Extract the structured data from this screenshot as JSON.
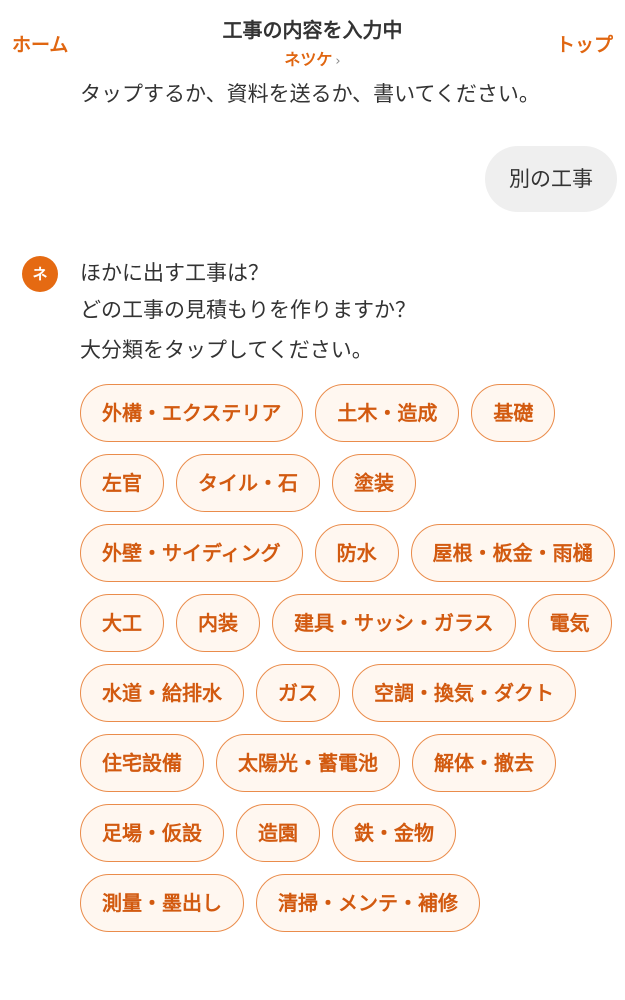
{
  "header": {
    "home": "ホーム",
    "title": "工事の内容を入力中",
    "subtitle": "ネツケ",
    "top": "トップ"
  },
  "previous_message": "タップするか、資料を送るか、書いてください。",
  "user_message": "別の工事",
  "bot": {
    "avatar": "ネ",
    "lines": [
      "ほかに出す工事は？",
      "どの工事の見積もりを作りますか？",
      "大分類をタップしてください。"
    ]
  },
  "categories": [
    "外構・エクステリア",
    "土木・造成",
    "基礎",
    "左官",
    "タイル・石",
    "塗装",
    "外壁・サイディング",
    "防水",
    "屋根・板金・雨樋",
    "大工",
    "内装",
    "建具・サッシ・ガラス",
    "電気",
    "水道・給排水",
    "ガス",
    "空調・換気・ダクト",
    "住宅設備",
    "太陽光・蓄電池",
    "解体・撤去",
    "足場・仮設",
    "造園",
    "鉄・金物",
    "測量・墨出し",
    "清掃・メンテ・補修"
  ],
  "colors": {
    "accent": "#e06611",
    "chip_border": "#ea8c4b",
    "chip_bg": "#fff7f0",
    "bubble_bg": "#efefef"
  }
}
